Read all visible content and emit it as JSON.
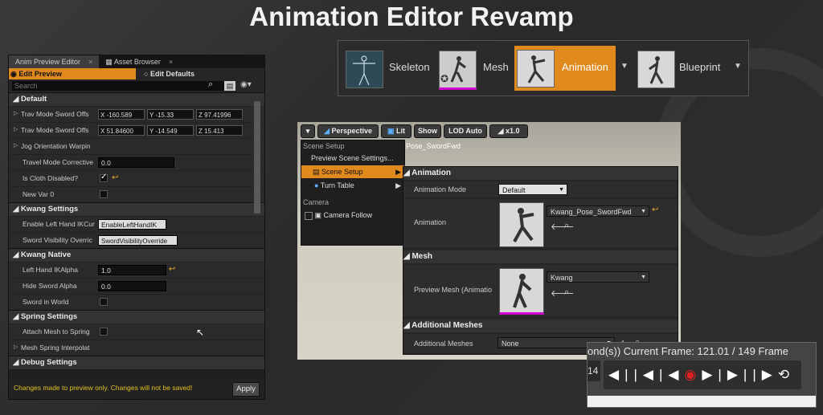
{
  "slide_title": "Animation Editor Revamp",
  "left_panel": {
    "tabs": [
      "Anim Preview Editor",
      "Asset Browser"
    ],
    "modes": [
      "Edit Preview",
      "Edit Defaults"
    ],
    "search_placeholder": "Search",
    "categories": {
      "default": "Default",
      "kwang_settings": "Kwang Settings",
      "kwang_native": "Kwang Native",
      "spring_settings": "Spring Settings",
      "debug_settings": "Debug Settings"
    },
    "rows": {
      "trav1": {
        "label": "Trav Mode Sword Offs",
        "x": "-160.589",
        "y": "-15.33",
        "z": "97.41996"
      },
      "trav2": {
        "label": "Trav Mode Sword Offs",
        "x": "51.84600",
        "y": "-14.549",
        "z": "15.413"
      },
      "jog": {
        "label": "Jog Orientation Warpin"
      },
      "travel_corrective": {
        "label": "Travel Mode Corrective",
        "value": "0.0"
      },
      "cloth_disabled": {
        "label": "Is Cloth Disabled?"
      },
      "new_var": {
        "label": "New Var 0"
      },
      "enable_left_hand": {
        "label": "Enable Left Hand IKCur",
        "value": "EnableLeftHandIK"
      },
      "sword_visibility": {
        "label": "Sword Visibility Overric",
        "value": "SwordVisibilityOverride"
      },
      "left_hand_alpha": {
        "label": "Left Hand IKAlpha",
        "value": "1.0"
      },
      "hide_sword_alpha": {
        "label": "Hide Sword Alpha",
        "value": "0.0"
      },
      "sword_in_world": {
        "label": "Sword in World"
      },
      "attach_mesh": {
        "label": "Attach Mesh to Spring"
      },
      "mesh_spring": {
        "label": "Mesh Spring Interpolat"
      }
    },
    "footer_notice": "Changes made to preview only. Changes will not be saved!",
    "apply_label": "Apply"
  },
  "asset_bar": {
    "items": [
      "Skeleton",
      "Mesh",
      "Animation",
      "Blueprint"
    ],
    "selected": "Animation",
    "accent_color": "#e08a1e"
  },
  "viewport": {
    "buttons": {
      "perspective": "Perspective",
      "lit": "Lit",
      "show": "Show",
      "lod": "LOD Auto",
      "speed": "x1.0"
    },
    "overlay_text": "Pose_SwordFwd",
    "menu": {
      "scene_setup_header": "Scene Setup",
      "preview_scene_settings": "Preview Scene Settings...",
      "scene_setup": "Scene Setup",
      "turn_table": "Turn Table",
      "camera_header": "Camera",
      "camera_follow": "Camera Follow"
    },
    "details": {
      "animation_cat": "Animation",
      "animation_mode_label": "Animation Mode",
      "animation_mode_value": "Default",
      "animation_label": "Animation",
      "animation_value": "Kwang_Pose_SwordFwd",
      "mesh_cat": "Mesh",
      "preview_mesh_label": "Preview Mesh (Animatio",
      "preview_mesh_value": "Kwang",
      "additional_cat": "Additional Meshes",
      "additional_label": "Additional Meshes",
      "additional_value": "None"
    }
  },
  "transport": {
    "frame_text": "ond(s))  Current Frame:  121.01 / 149 Frame",
    "side_number": "14"
  }
}
